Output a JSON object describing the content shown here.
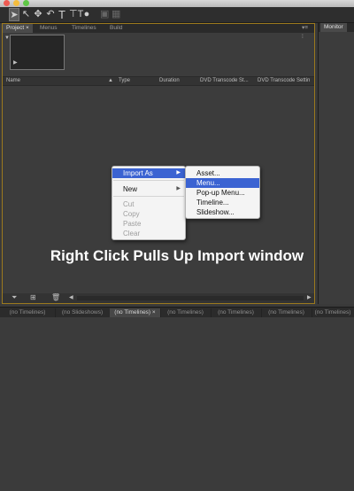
{
  "panel_tabs": [
    "Project",
    "Menus",
    "Timelines",
    "Build"
  ],
  "monitor_tab": "Monitor",
  "columns": [
    "Name",
    "Type",
    "Duration",
    "DVD Transcode St...",
    "DVD Transcode Settin"
  ],
  "context_menu": {
    "items": [
      "Import As",
      "New",
      "Cut",
      "Copy",
      "Paste",
      "Clear"
    ]
  },
  "submenu": {
    "items": [
      "Asset...",
      "Menu...",
      "Pop-up Menu...",
      "Timeline...",
      "Slideshow..."
    ],
    "highlighted": "Menu..."
  },
  "caption": "Right Click Pulls Up Import window",
  "lower_tabs": [
    "(no Timelines)",
    "(no Slideshows)",
    "(no Timelines)",
    "(no Timelines)",
    "(no Timelines)",
    "(no Timelines)",
    "(no Timelines)"
  ],
  "colors": {
    "accent_border": "#9c7a1e",
    "menu_highlight": "#3b63d2"
  }
}
